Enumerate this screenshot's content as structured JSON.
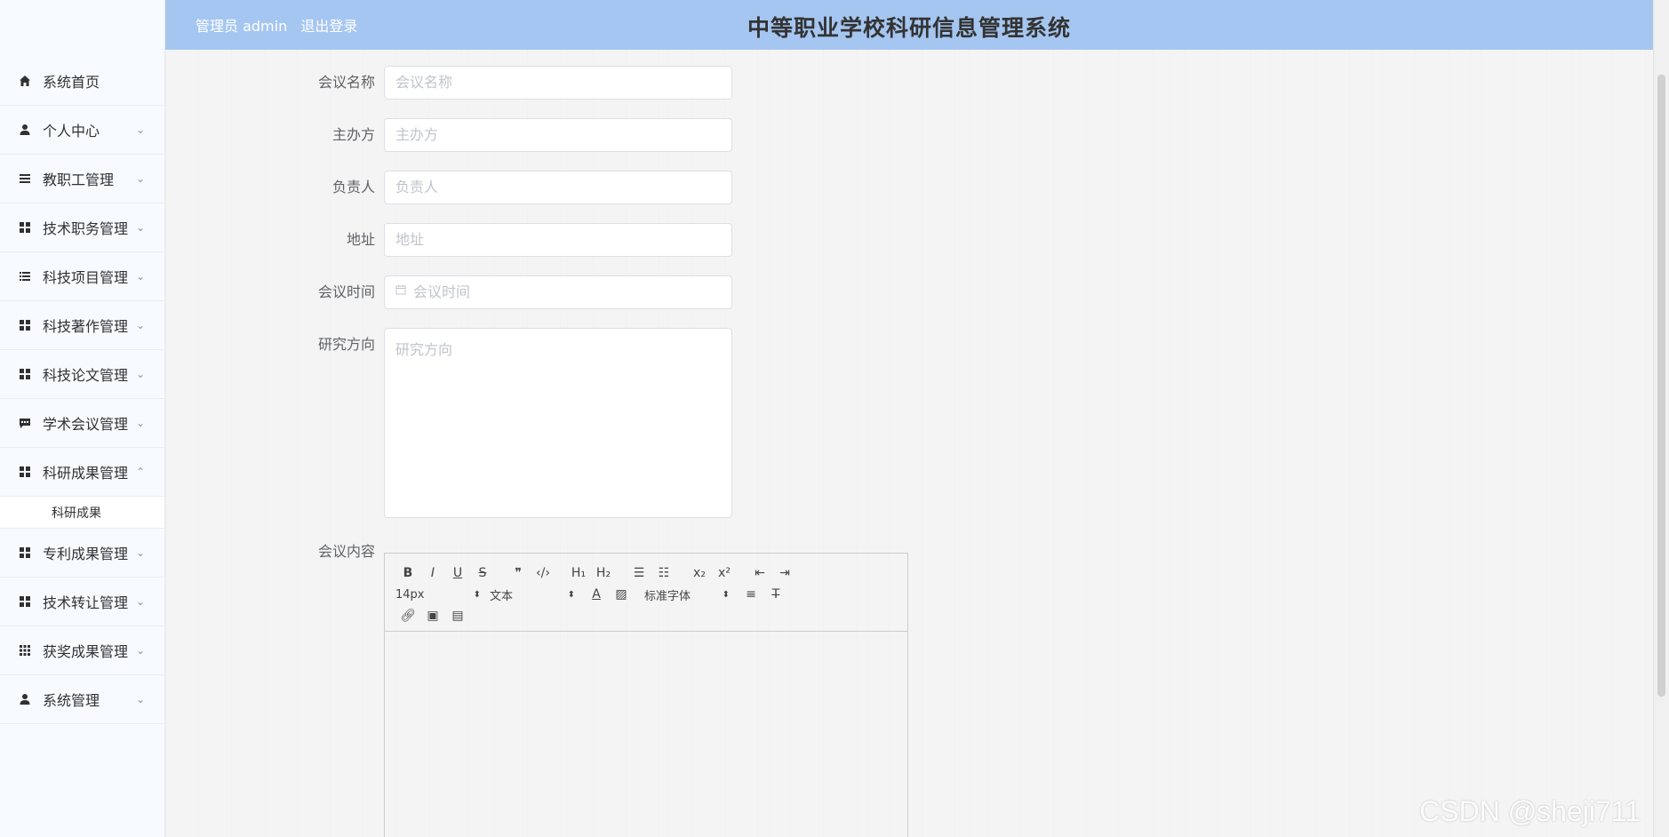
{
  "header": {
    "user_label": "管理员 admin",
    "logout_label": "退出登录",
    "title": "中等职业学校科研信息管理系统"
  },
  "sidebar": {
    "items": [
      {
        "label": "系统首页",
        "icon": "home-icon",
        "arrow": ""
      },
      {
        "label": "个人中心",
        "icon": "user-icon",
        "arrow": "chevron-down"
      },
      {
        "label": "教职工管理",
        "icon": "list-icon",
        "arrow": "chevron-down"
      },
      {
        "label": "技术职务管理",
        "icon": "grid-icon",
        "arrow": "chevron-down"
      },
      {
        "label": "科技项目管理",
        "icon": "list-icon",
        "arrow": "chevron-down"
      },
      {
        "label": "科技著作管理",
        "icon": "grid-icon",
        "arrow": "chevron-down"
      },
      {
        "label": "科技论文管理",
        "icon": "grid-icon",
        "arrow": "chevron-down"
      },
      {
        "label": "学术会议管理",
        "icon": "comment-icon",
        "arrow": "chevron-down"
      },
      {
        "label": "科研成果管理",
        "icon": "grid-icon",
        "arrow": "chevron-up"
      },
      {
        "label": "专利成果管理",
        "icon": "grid-icon",
        "arrow": "chevron-down"
      },
      {
        "label": "技术转让管理",
        "icon": "grid-icon",
        "arrow": "chevron-down"
      },
      {
        "label": "获奖成果管理",
        "icon": "apps-icon",
        "arrow": "chevron-down"
      },
      {
        "label": "系统管理",
        "icon": "user-icon",
        "arrow": "chevron-down"
      }
    ],
    "sub_item": "科研成果"
  },
  "form": {
    "meeting_name": {
      "label": "会议名称",
      "placeholder": "会议名称"
    },
    "organizer": {
      "label": "主办方",
      "placeholder": "主办方"
    },
    "person_in_charge": {
      "label": "负责人",
      "placeholder": "负责人"
    },
    "address": {
      "label": "地址",
      "placeholder": "地址"
    },
    "meeting_time": {
      "label": "会议时间",
      "placeholder": "会议时间"
    },
    "research_direction": {
      "label": "研究方向",
      "placeholder": "研究方向"
    },
    "meeting_content": {
      "label": "会议内容"
    }
  },
  "editor": {
    "font_size": "14px",
    "paragraph": "文本",
    "font_family": "标准字体"
  },
  "watermark": "CSDN @sheji711"
}
